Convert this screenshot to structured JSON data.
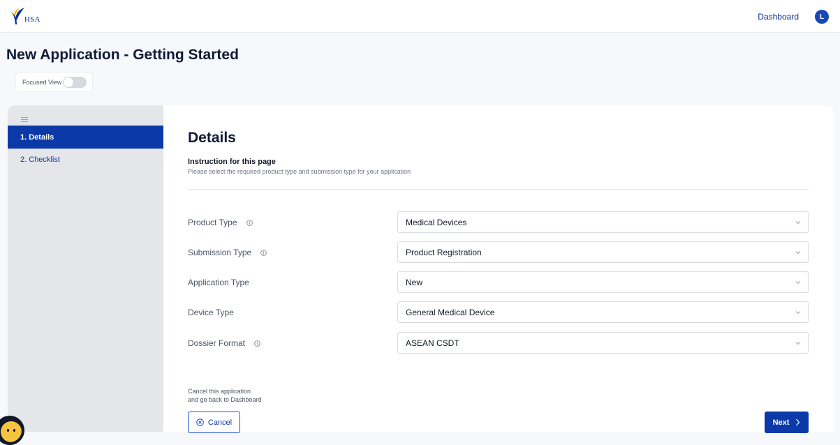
{
  "header": {
    "logo_text": "HSA",
    "nav_dashboard": "Dashboard",
    "avatar_initial": "L"
  },
  "page": {
    "title": "New Application - Getting Started",
    "focused_view_label": "Focused View",
    "focused_view_enabled": false
  },
  "sidebar": {
    "steps": [
      {
        "label": "1. Details",
        "active": true
      },
      {
        "label": "2. Checklist",
        "active": false
      }
    ]
  },
  "details": {
    "title": "Details",
    "instruction_heading": "Instruction for this page",
    "instruction_text": "Please select the required product type and submission type for your application"
  },
  "form": {
    "fields": [
      {
        "label": "Product Type",
        "value": "Medical Devices",
        "has_info": true
      },
      {
        "label": "Submission Type",
        "value": "Product Registration",
        "has_info": true
      },
      {
        "label": "Application Type",
        "value": "New",
        "has_info": false
      },
      {
        "label": "Device Type",
        "value": "General Medical Device",
        "has_info": false
      },
      {
        "label": "Dossier Format",
        "value": "ASEAN CSDT",
        "has_info": true
      }
    ]
  },
  "footer": {
    "cancel_note_line1": "Cancel this application",
    "cancel_note_line2": "and go back to Dashboard",
    "cancel_label": "Cancel",
    "next_label": "Next"
  },
  "colors": {
    "primary": "#0b3aa8",
    "sidebar_bg": "#e4e6ea",
    "page_bg": "#f7f8fb"
  },
  "icons": {
    "logo": "hsa-logo",
    "menu": "hamburger-menu-icon",
    "info": "info-icon",
    "dropdown": "chevron-down-icon",
    "cancel": "close-circle-icon",
    "next": "chevron-right-icon",
    "chat": "chatbot-icon"
  }
}
